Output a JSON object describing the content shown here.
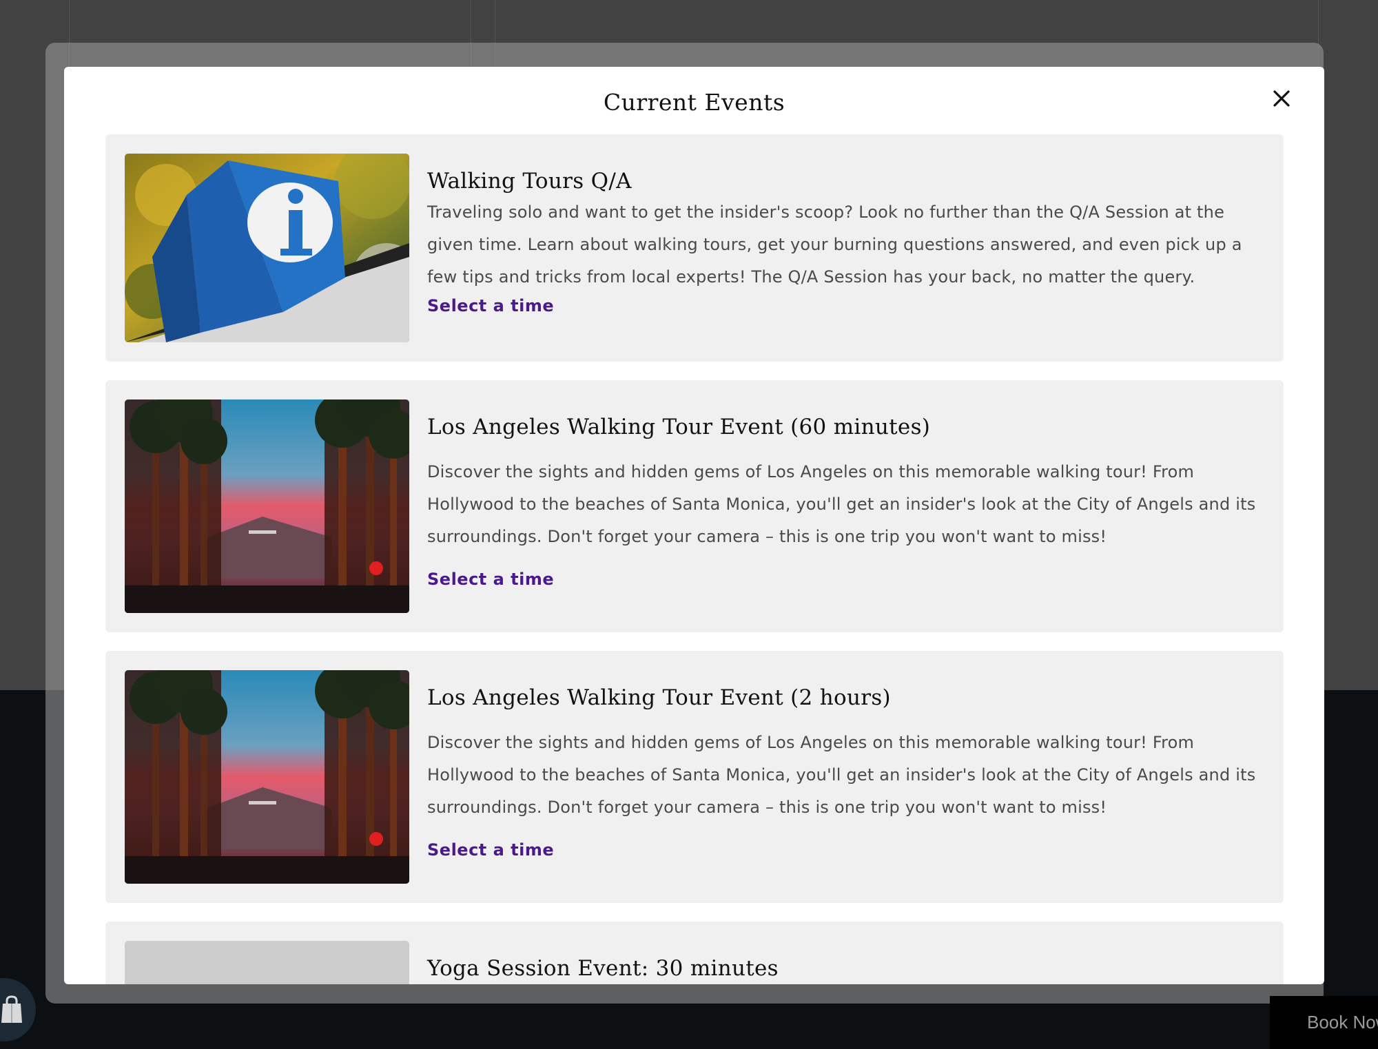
{
  "modal": {
    "title": "Current Events",
    "close_icon": "close-icon"
  },
  "events": [
    {
      "title": "Walking Tours Q/A",
      "description": "Traveling solo and want to get the insider's scoop? Look no further than the Q/A Session at the given time. Learn about walking tours, get your burning questions answered, and even pick up a few tips and tricks from local experts! The Q/A Session has your back, no matter the query.",
      "link": "Select a time",
      "image": "info-sign-image"
    },
    {
      "title": "Los Angeles Walking Tour Event (60 minutes)",
      "description": "Discover the sights and hidden gems of Los Angeles on this memorable walking tour! From Hollywood to the beaches of Santa Monica, you'll get an insider's look at the City of Angels and its surroundings. Don't forget your camera – this is one trip you won't want to miss!",
      "link": "Select a time",
      "image": "palm-trees-hollywood-image"
    },
    {
      "title": "Los Angeles Walking Tour Event (2 hours)",
      "description": "Discover the sights and hidden gems of Los Angeles on this memorable walking tour! From Hollywood to the beaches of Santa Monica, you'll get an insider's look at the City of Angels and its surroundings. Don't forget your camera – this is one trip you won't want to miss!",
      "link": "Select a time",
      "image": "palm-trees-hollywood-image"
    },
    {
      "title": "Yoga Session Event: 30 minutes",
      "image": "placeholder-image"
    }
  ],
  "footer": {
    "book_now": "Book Now",
    "cart_icon": "shopping-bag-icon"
  }
}
